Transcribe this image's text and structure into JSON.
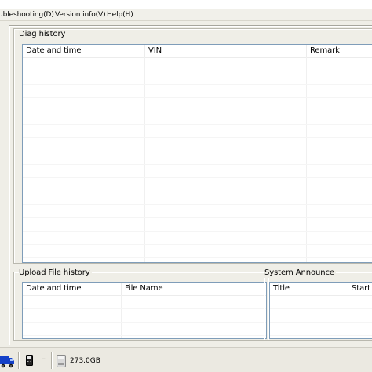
{
  "menu": {
    "troubleshooting": "ubleshooting(D)",
    "version_info": "Version info(V)",
    "help": "Help(H)"
  },
  "diag_history": {
    "title": "Diag history",
    "columns": [
      "Date and time",
      "VIN",
      "Remark"
    ],
    "rows": []
  },
  "upload_file_history": {
    "title": "Upload File history",
    "columns": [
      "Date and time",
      "File Name"
    ],
    "rows": []
  },
  "system_announce": {
    "title": "System Announce",
    "columns": [
      "Title",
      "Start"
    ],
    "rows": []
  },
  "taskbar": {
    "separator_dash": "–",
    "drive_size": "273.0GB"
  },
  "colors": {
    "menubar_bg": "#f1f0ea",
    "window_bg": "#efeee7",
    "listview_border": "#7f9db9",
    "truck_blue": "#1440c8"
  },
  "icons": [
    "truck-icon",
    "phone-icon",
    "drive-icon"
  ]
}
